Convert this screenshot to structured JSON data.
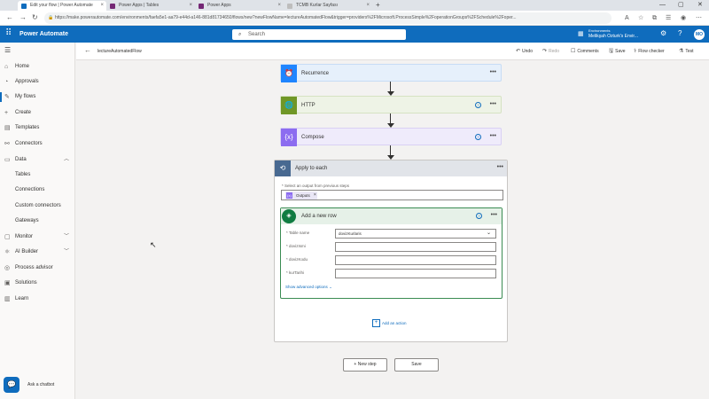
{
  "browser": {
    "tabs": [
      {
        "title": "Edit your flow | Power Automate",
        "color": "#0f6cbd",
        "active": true
      },
      {
        "title": "Power Apps | Tables",
        "color": "#742774",
        "active": false
      },
      {
        "title": "Power Apps",
        "color": "#742774",
        "active": false
      },
      {
        "title": "TCMB Kurlar Sayfası",
        "color": "#9e9e9e",
        "active": false
      }
    ],
    "url": "https://make.powerautomate.com/environments/faefa5e1-aa79-e44d-a146-881d81734650/flows/new?newFlowName=lectureAutomatedFlow&trigger=providers%2FMicrosoft.ProcessSimple%2FoperationGroups%2FSchedule%2Foper..."
  },
  "header": {
    "app_title": "Power Automate",
    "search_placeholder": "Search",
    "environment_label": "Environments",
    "environment_name": "Melikşah Ozturk's Envir...",
    "avatar_initials": "MO"
  },
  "sidebar": {
    "items": [
      {
        "label": "Home",
        "icon": "home-icon"
      },
      {
        "label": "Approvals",
        "icon": "approvals-icon"
      },
      {
        "label": "My flows",
        "icon": "flows-icon",
        "active": true
      },
      {
        "label": "Create",
        "icon": "plus-icon"
      },
      {
        "label": "Templates",
        "icon": "templates-icon"
      },
      {
        "label": "Connectors",
        "icon": "connectors-icon"
      },
      {
        "label": "Data",
        "icon": "data-icon",
        "expanded": true
      },
      {
        "label": "Tables",
        "sub": true
      },
      {
        "label": "Connections",
        "sub": true
      },
      {
        "label": "Custom connectors",
        "sub": true
      },
      {
        "label": "Gateways",
        "sub": true
      },
      {
        "label": "Monitor",
        "icon": "monitor-icon"
      },
      {
        "label": "AI Builder",
        "icon": "ai-builder-icon"
      },
      {
        "label": "Process advisor",
        "icon": "process-advisor-icon"
      },
      {
        "label": "Solutions",
        "icon": "solutions-icon"
      },
      {
        "label": "Learn",
        "icon": "learn-icon"
      }
    ],
    "chatbot_label": "Ask a chatbot"
  },
  "command_bar": {
    "flow_name": "lectureAutomatedFlow",
    "undo": "Undo",
    "redo": "Redo",
    "comments": "Comments",
    "save": "Save",
    "flow_checker": "Flow checker",
    "test": "Test"
  },
  "flow": {
    "steps": [
      {
        "title": "Recurrence",
        "color": "#1f85ff",
        "bg": "#e6f0fb",
        "icon": "clock-icon"
      },
      {
        "title": "HTTP",
        "color": "#709727",
        "bg": "#eef3e6",
        "icon": "globe-icon"
      },
      {
        "title": "Compose",
        "color": "#8c6cf0",
        "bg": "#efebfb",
        "icon": "compose-icon"
      }
    ],
    "apply_to_each": {
      "title": "Apply to each",
      "select_label": "* Select an output from previous steps",
      "token": "Outputs"
    },
    "add_row": {
      "title": "Add a new row",
      "fields": [
        {
          "label": "* Table name",
          "value": "dovizKurlaris"
        },
        {
          "label": "* dovizIsmi",
          "value": ""
        },
        {
          "label": "* dovizKodu",
          "value": ""
        },
        {
          "label": "* kurTarihi",
          "value": ""
        }
      ],
      "show_advanced": "Show advanced options"
    },
    "add_action": "Add an action",
    "new_step": "+ New step",
    "save_button": "Save"
  }
}
